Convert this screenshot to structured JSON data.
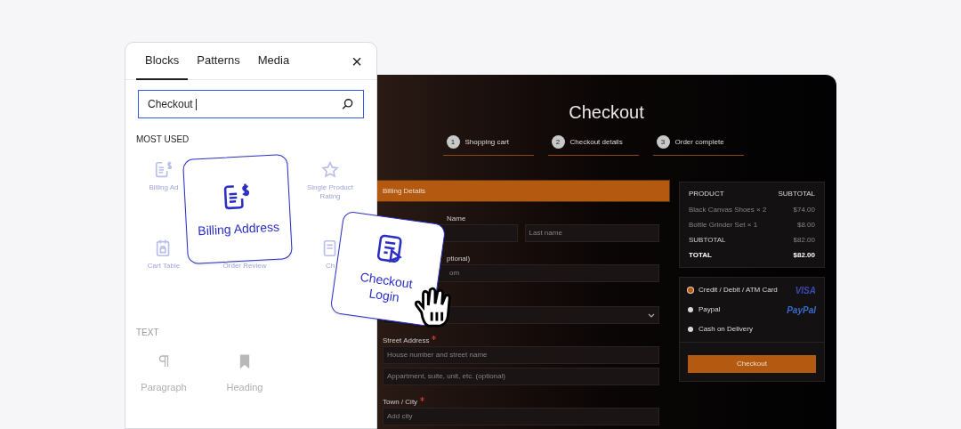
{
  "inserter": {
    "tabs": [
      {
        "label": "Blocks",
        "selected": true
      },
      {
        "label": "Patterns",
        "selected": false
      },
      {
        "label": "Media",
        "selected": false
      }
    ],
    "close": "×",
    "search": {
      "value": "Checkout"
    },
    "sections": [
      {
        "title": "MOST USED",
        "rows": [
          [
            {
              "label": "Billing Ad",
              "kind": "billing"
            },
            null,
            {
              "label": "Single Product Rating",
              "kind": "star"
            }
          ],
          [
            {
              "label": "Cart Table",
              "kind": "cart"
            },
            {
              "label": "Order Review",
              "kind": "list"
            },
            {
              "label": "Ch",
              "kind": "doc"
            }
          ]
        ]
      },
      {
        "title": "TEXT",
        "rows": [
          [
            {
              "label": "Paragraph",
              "kind": "pilcrow"
            },
            {
              "label": "Heading",
              "kind": "bookmark"
            },
            null
          ]
        ]
      }
    ]
  },
  "checkout": {
    "title": "Checkout",
    "steps": [
      {
        "number": "1",
        "label": "Shopping cart"
      },
      {
        "number": "2",
        "label": "Checkout details"
      },
      {
        "number": "3",
        "label": "Order complete"
      }
    ],
    "billing_header": "Billing Details",
    "form": [
      {
        "label": "Name",
        "required": false,
        "fields": [
          {
            "kind": "input"
          },
          {
            "kind": "input",
            "placeholder": "Last name"
          }
        ]
      },
      {
        "label": "ptional)",
        "required": false,
        "fields": [
          {
            "kind": "input",
            "placeholder": "om"
          }
        ]
      },
      {
        "fields": [
          {
            "kind": "select"
          }
        ]
      },
      {
        "label": "Street Address",
        "required": true,
        "fields": [
          {
            "kind": "input",
            "placeholder": "House number and street name"
          }
        ]
      },
      {
        "fields": [
          {
            "kind": "input",
            "placeholder": "Appartment, suite, unit, etc. (optional)"
          }
        ]
      },
      {
        "label": "Town / City",
        "required": true,
        "fields": [
          {
            "kind": "input",
            "placeholder": "Add city"
          }
        ]
      }
    ],
    "summary": {
      "header": [
        "PRODUCT",
        "SUBTOTAL"
      ],
      "rows": [
        {
          "kind": "item",
          "name": "Black Canvas Shoes × 2",
          "amount": "$74.00"
        },
        {
          "kind": "item",
          "name": "Bottle Grinder Set × 1",
          "amount": "$8.00"
        },
        {
          "kind": "subtotal",
          "name": "SUBTOTAL",
          "amount": "$82.00"
        },
        {
          "kind": "total",
          "name": "TOTAL",
          "amount": "$82.00"
        }
      ]
    },
    "payment": [
      {
        "label": "Credit / Debit / ATM Card",
        "selected": true,
        "logo": "VISA"
      },
      {
        "label": "Paypal",
        "selected": false,
        "logo": "PayPal"
      },
      {
        "label": "Cash on Delivery",
        "selected": false
      }
    ],
    "button": "Checkout"
  },
  "cards": [
    {
      "label": "Billing Address",
      "kind": "billing"
    },
    {
      "label": "Checkout Login",
      "kind": "login"
    }
  ]
}
